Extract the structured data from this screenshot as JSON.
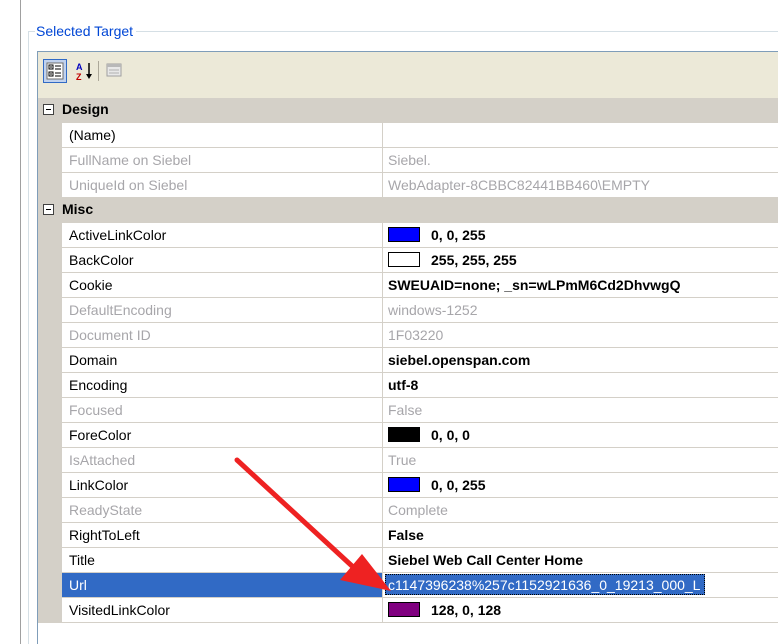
{
  "group": {
    "title": "Selected Target"
  },
  "toolbar": {
    "categorized_icon": "categorized-view-icon",
    "alphabetical_icon": "sort-alphabetical-icon",
    "property_pages_icon": "property-pages-icon"
  },
  "colors": {
    "selection": "#316ac5",
    "category_bg": "#d4d0c8",
    "readonly_text": "#a7a6aa",
    "annotation_arrow": "#ee2222"
  },
  "categories": [
    {
      "label": "Design",
      "rows": [
        {
          "name": "(Name)",
          "value": ""
        },
        {
          "name": "FullName on Siebel",
          "value": "Siebel."
        },
        {
          "name": "UniqueId on Siebel",
          "value": "WebAdapter-8CBBC82441BB460\\EMPTY"
        }
      ]
    },
    {
      "label": "Misc",
      "rows": [
        {
          "name": "ActiveLinkColor",
          "value": "0, 0, 255",
          "swatch": "#0000ff"
        },
        {
          "name": "BackColor",
          "value": "255, 255, 255",
          "swatch": "#ffffff"
        },
        {
          "name": "Cookie",
          "value": "SWEUAID=none; _sn=wLPmM6Cd2DhvwgQ"
        },
        {
          "name": "DefaultEncoding",
          "value": "windows-1252"
        },
        {
          "name": "Document ID",
          "value": "1F03220"
        },
        {
          "name": "Domain",
          "value": "siebel.openspan.com"
        },
        {
          "name": "Encoding",
          "value": "utf-8"
        },
        {
          "name": "Focused",
          "value": "False"
        },
        {
          "name": "ForeColor",
          "value": "0, 0, 0",
          "swatch": "#000000"
        },
        {
          "name": "IsAttached",
          "value": "True"
        },
        {
          "name": "LinkColor",
          "value": "0, 0, 255",
          "swatch": "#0000ff"
        },
        {
          "name": "ReadyState",
          "value": "Complete"
        },
        {
          "name": "RightToLeft",
          "value": "False"
        },
        {
          "name": "Title",
          "value": "Siebel Web Call Center Home"
        },
        {
          "name": "Url",
          "value": "c1147396238%257c1152921636_0_19213_000_L"
        },
        {
          "name": "VisitedLinkColor",
          "value": "128, 0, 128",
          "swatch": "#800080"
        }
      ]
    }
  ]
}
